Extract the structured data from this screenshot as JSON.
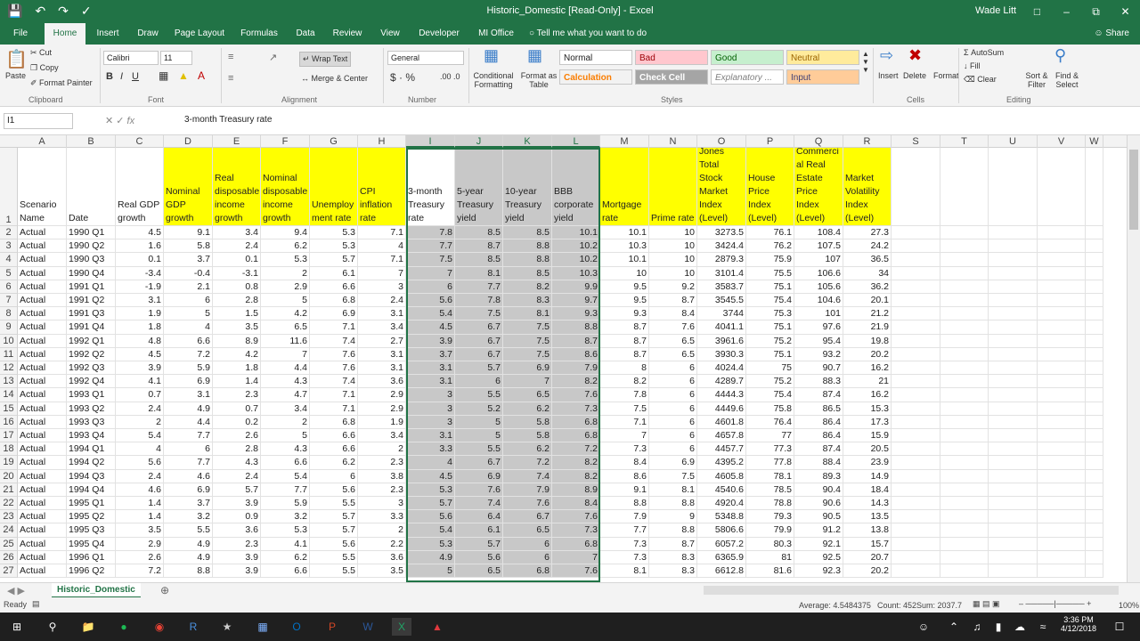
{
  "window": {
    "title": "Historic_Domestic  [Read-Only]  -  Excel",
    "user": "Wade Litt"
  },
  "menu_tabs": [
    "File",
    "Home",
    "Insert",
    "Draw",
    "Page Layout",
    "Formulas",
    "Data",
    "Review",
    "View",
    "Developer",
    "MI Office"
  ],
  "tell_me": "Tell me what you want to do",
  "share": "Share",
  "ribbon": {
    "clipboard": {
      "paste": "Paste",
      "cut": "Cut",
      "copy": "Copy",
      "format_painter": "Format Painter",
      "group": "Clipboard"
    },
    "font": {
      "name": "Calibri",
      "size": "11",
      "group": "Font"
    },
    "alignment": {
      "wrap": "Wrap Text",
      "merge": "Merge & Center",
      "group": "Alignment"
    },
    "number": {
      "format": "General",
      "group": "Number"
    },
    "styles": {
      "conditional": "Conditional Formatting",
      "format_table": "Format as Table",
      "normal": "Normal",
      "bad": "Bad",
      "good": "Good",
      "neutral": "Neutral",
      "calculation": "Calculation",
      "check_cell": "Check Cell",
      "explanatory": "Explanatory ...",
      "input": "Input",
      "group": "Styles"
    },
    "cells": {
      "insert": "Insert",
      "delete": "Delete",
      "format": "Format",
      "group": "Cells"
    },
    "editing": {
      "autosum": "AutoSum",
      "fill": "Fill",
      "clear": "Clear",
      "sort": "Sort & Filter",
      "find": "Find & Select",
      "group": "Editing"
    }
  },
  "formula_bar": {
    "name_box": "I1",
    "value": "3-month Treasury rate"
  },
  "columns": [
    "A",
    "B",
    "C",
    "D",
    "E",
    "F",
    "G",
    "H",
    "I",
    "J",
    "K",
    "L",
    "M",
    "N",
    "O",
    "P",
    "Q",
    "R",
    "S",
    "T",
    "U",
    "V",
    "W"
  ],
  "headers": [
    "Scenario Name",
    "Date",
    "Real GDP growth",
    "Nominal GDP growth",
    "Real disposable income growth",
    "Nominal disposable income growth",
    "Unemploy ment rate",
    "CPI inflation rate",
    "3-month Treasury rate",
    "5-year Treasury yield",
    "10-year Treasury yield",
    "BBB corporate yield",
    "Mortgage rate",
    "Prime rate",
    "Dow Jones Total Stock Market Index (Level)",
    "House Price Index (Level)",
    "Commerci al Real Estate Price Index (Level)",
    "Market Volatility Index (Level)"
  ],
  "rows": [
    [
      "Actual",
      "1990 Q1",
      "4.5",
      "9.1",
      "3.4",
      "9.4",
      "5.3",
      "7.1",
      "7.8",
      "8.5",
      "8.5",
      "10.1",
      "10.1",
      "10",
      "3273.5",
      "76.1",
      "108.4",
      "27.3"
    ],
    [
      "Actual",
      "1990 Q2",
      "1.6",
      "5.8",
      "2.4",
      "6.2",
      "5.3",
      "4",
      "7.7",
      "8.7",
      "8.8",
      "10.2",
      "10.3",
      "10",
      "3424.4",
      "76.2",
      "107.5",
      "24.2"
    ],
    [
      "Actual",
      "1990 Q3",
      "0.1",
      "3.7",
      "0.1",
      "5.3",
      "5.7",
      "7.1",
      "7.5",
      "8.5",
      "8.8",
      "10.2",
      "10.1",
      "10",
      "2879.3",
      "75.9",
      "107",
      "36.5"
    ],
    [
      "Actual",
      "1990 Q4",
      "-3.4",
      "-0.4",
      "-3.1",
      "2",
      "6.1",
      "7",
      "7",
      "8.1",
      "8.5",
      "10.3",
      "10",
      "10",
      "3101.4",
      "75.5",
      "106.6",
      "34"
    ],
    [
      "Actual",
      "1991 Q1",
      "-1.9",
      "2.1",
      "0.8",
      "2.9",
      "6.6",
      "3",
      "6",
      "7.7",
      "8.2",
      "9.9",
      "9.5",
      "9.2",
      "3583.7",
      "75.1",
      "105.6",
      "36.2"
    ],
    [
      "Actual",
      "1991 Q2",
      "3.1",
      "6",
      "2.8",
      "5",
      "6.8",
      "2.4",
      "5.6",
      "7.8",
      "8.3",
      "9.7",
      "9.5",
      "8.7",
      "3545.5",
      "75.4",
      "104.6",
      "20.1"
    ],
    [
      "Actual",
      "1991 Q3",
      "1.9",
      "5",
      "1.5",
      "4.2",
      "6.9",
      "3.1",
      "5.4",
      "7.5",
      "8.1",
      "9.3",
      "9.3",
      "8.4",
      "3744",
      "75.3",
      "101",
      "21.2"
    ],
    [
      "Actual",
      "1991 Q4",
      "1.8",
      "4",
      "3.5",
      "6.5",
      "7.1",
      "3.4",
      "4.5",
      "6.7",
      "7.5",
      "8.8",
      "8.7",
      "7.6",
      "4041.1",
      "75.1",
      "97.6",
      "21.9"
    ],
    [
      "Actual",
      "1992 Q1",
      "4.8",
      "6.6",
      "8.9",
      "11.6",
      "7.4",
      "2.7",
      "3.9",
      "6.7",
      "7.5",
      "8.7",
      "8.7",
      "6.5",
      "3961.6",
      "75.2",
      "95.4",
      "19.8"
    ],
    [
      "Actual",
      "1992 Q2",
      "4.5",
      "7.2",
      "4.2",
      "7",
      "7.6",
      "3.1",
      "3.7",
      "6.7",
      "7.5",
      "8.6",
      "8.7",
      "6.5",
      "3930.3",
      "75.1",
      "93.2",
      "20.2"
    ],
    [
      "Actual",
      "1992 Q3",
      "3.9",
      "5.9",
      "1.8",
      "4.4",
      "7.6",
      "3.1",
      "3.1",
      "5.7",
      "6.9",
      "7.9",
      "8",
      "6",
      "4024.4",
      "75",
      "90.7",
      "16.2"
    ],
    [
      "Actual",
      "1992 Q4",
      "4.1",
      "6.9",
      "1.4",
      "4.3",
      "7.4",
      "3.6",
      "3.1",
      "6",
      "7",
      "8.2",
      "8.2",
      "6",
      "4289.7",
      "75.2",
      "88.3",
      "21"
    ],
    [
      "Actual",
      "1993 Q1",
      "0.7",
      "3.1",
      "2.3",
      "4.7",
      "7.1",
      "2.9",
      "3",
      "5.5",
      "6.5",
      "7.6",
      "7.8",
      "6",
      "4444.3",
      "75.4",
      "87.4",
      "16.2"
    ],
    [
      "Actual",
      "1993 Q2",
      "2.4",
      "4.9",
      "0.7",
      "3.4",
      "7.1",
      "2.9",
      "3",
      "5.2",
      "6.2",
      "7.3",
      "7.5",
      "6",
      "4449.6",
      "75.8",
      "86.5",
      "15.3"
    ],
    [
      "Actual",
      "1993 Q3",
      "2",
      "4.4",
      "0.2",
      "2",
      "6.8",
      "1.9",
      "3",
      "5",
      "5.8",
      "6.8",
      "7.1",
      "6",
      "4601.8",
      "76.4",
      "86.4",
      "17.3"
    ],
    [
      "Actual",
      "1993 Q4",
      "5.4",
      "7.7",
      "2.6",
      "5",
      "6.6",
      "3.4",
      "3.1",
      "5",
      "5.8",
      "6.8",
      "7",
      "6",
      "4657.8",
      "77",
      "86.4",
      "15.9"
    ],
    [
      "Actual",
      "1994 Q1",
      "4",
      "6",
      "2.8",
      "4.3",
      "6.6",
      "2",
      "3.3",
      "5.5",
      "6.2",
      "7.2",
      "7.3",
      "6",
      "4457.7",
      "77.3",
      "87.4",
      "20.5"
    ],
    [
      "Actual",
      "1994 Q2",
      "5.6",
      "7.7",
      "4.3",
      "6.6",
      "6.2",
      "2.3",
      "4",
      "6.7",
      "7.2",
      "8.2",
      "8.4",
      "6.9",
      "4395.2",
      "77.8",
      "88.4",
      "23.9"
    ],
    [
      "Actual",
      "1994 Q3",
      "2.4",
      "4.6",
      "2.4",
      "5.4",
      "6",
      "3.8",
      "4.5",
      "6.9",
      "7.4",
      "8.2",
      "8.6",
      "7.5",
      "4605.8",
      "78.1",
      "89.3",
      "14.9"
    ],
    [
      "Actual",
      "1994 Q4",
      "4.6",
      "6.9",
      "5.7",
      "7.7",
      "5.6",
      "2.3",
      "5.3",
      "7.6",
      "7.9",
      "8.9",
      "9.1",
      "8.1",
      "4540.6",
      "78.5",
      "90.4",
      "18.4"
    ],
    [
      "Actual",
      "1995 Q1",
      "1.4",
      "3.7",
      "3.9",
      "5.9",
      "5.5",
      "3",
      "5.7",
      "7.4",
      "7.6",
      "8.4",
      "8.8",
      "8.8",
      "4920.4",
      "78.8",
      "90.6",
      "14.3"
    ],
    [
      "Actual",
      "1995 Q2",
      "1.4",
      "3.2",
      "0.9",
      "3.2",
      "5.7",
      "3.3",
      "5.6",
      "6.4",
      "6.7",
      "7.6",
      "7.9",
      "9",
      "5348.8",
      "79.3",
      "90.5",
      "13.5"
    ],
    [
      "Actual",
      "1995 Q3",
      "3.5",
      "5.5",
      "3.6",
      "5.3",
      "5.7",
      "2",
      "5.4",
      "6.1",
      "6.5",
      "7.3",
      "7.7",
      "8.8",
      "5806.6",
      "79.9",
      "91.2",
      "13.8"
    ],
    [
      "Actual",
      "1995 Q4",
      "2.9",
      "4.9",
      "2.3",
      "4.1",
      "5.6",
      "2.2",
      "5.3",
      "5.7",
      "6",
      "6.8",
      "7.3",
      "8.7",
      "6057.2",
      "80.3",
      "92.1",
      "15.7"
    ],
    [
      "Actual",
      "1996 Q1",
      "2.6",
      "4.9",
      "3.9",
      "6.2",
      "5.5",
      "3.6",
      "4.9",
      "5.6",
      "6",
      "7",
      "7.3",
      "8.3",
      "6365.9",
      "81",
      "92.5",
      "20.7"
    ],
    [
      "Actual",
      "1996 Q2",
      "7.2",
      "8.8",
      "3.9",
      "6.6",
      "5.5",
      "3.5",
      "5",
      "6.5",
      "6.8",
      "7.6",
      "8.1",
      "8.3",
      "6612.8",
      "81.6",
      "92.3",
      "20.2"
    ]
  ],
  "sheet_tab": "Historic_Domestic",
  "status": {
    "mode": "Ready",
    "average": "Average: 4.5484375",
    "count": "Count: 452",
    "sum": "Sum: 2037.7",
    "zoom": "100%"
  },
  "clock": {
    "time": "3:36 PM",
    "date": "4/12/2018"
  }
}
